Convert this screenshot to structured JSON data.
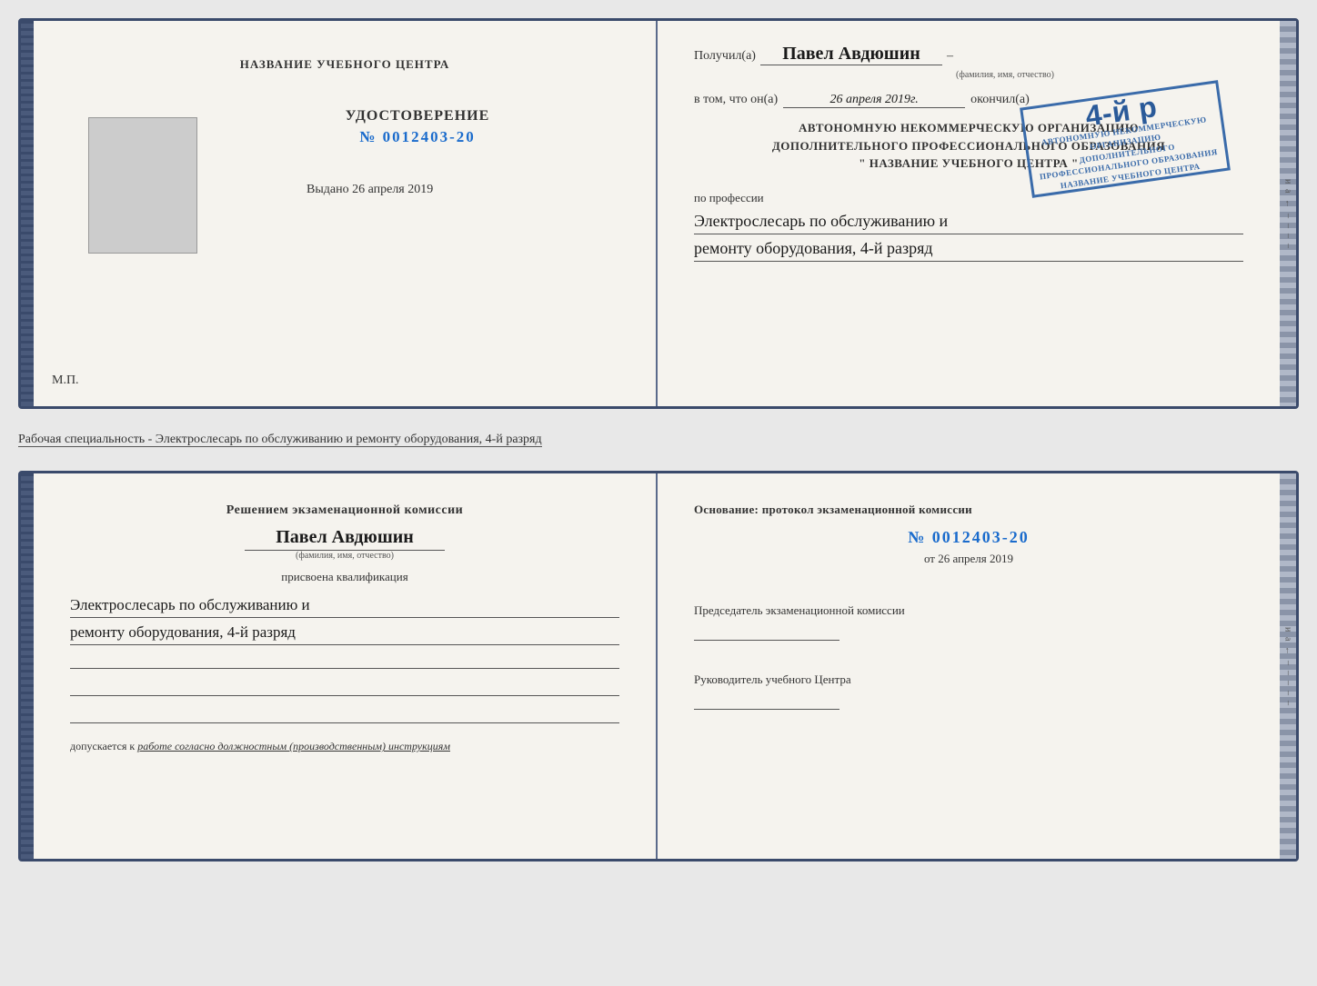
{
  "topDoc": {
    "leftPage": {
      "header": "НАЗВАНИЕ УЧЕБНОГО ЦЕНТРА",
      "certLabel": "УДОСТОВЕРЕНИЕ",
      "certNumber": "№ 0012403-20",
      "issuedLabel": "Выдано",
      "issuedDate": "26 апреля 2019",
      "mpLabel": "М.П."
    },
    "rightPage": {
      "receivedLabel": "Получил(а)",
      "recipientName": "Павел Авдюшин",
      "nameSubLabel": "(фамилия, имя, отчество)",
      "vtomLabel": "в том, что он(а)",
      "completionDate": "26 апреля 2019г.",
      "finishedLabel": "окончил(а)",
      "orgLine1": "АВТОНОМНУЮ НЕКОММЕРЧЕСКУЮ ОРГАНИЗАЦИЮ",
      "orgLine2": "ДОПОЛНИТЕЛЬНОГО ПРОФЕССИОНАЛЬНОГО ОБРАЗОВАНИЯ",
      "orgLine3": "\" НАЗВАНИЕ УЧЕБНОГО ЦЕНТРА \"",
      "professionLabel": "по профессии",
      "professionLine1": "Электрослесарь по обслуживанию и",
      "professionLine2": "ремонту оборудования, 4-й разряд",
      "stamp": {
        "line1": "4-й р",
        "line2": "АВТОНОМНУЮ НЕКОММЕРЧЕСКУЮ ОРГАНИЗАЦИЮ",
        "line3": "ДОПОЛНИТЕЛЬНОГО ПРОФЕССИОНАЛЬНОГО ОБРАЗОВАНИЯ",
        "line4": "НАЗВАНИЕ УЧЕБНОГО ЦЕНТРА"
      }
    }
  },
  "specialtyText": "Рабочая специальность - Электрослесарь по обслуживанию и ремонту оборудования, 4-й разряд",
  "bottomDoc": {
    "leftPage": {
      "commissionText": "Решением экзаменационной комиссии",
      "name": "Павел Авдюшин",
      "nameSubLabel": "(фамилия, имя, отчество)",
      "assignedText": "присвоена квалификация",
      "qualLine1": "Электрослесарь по обслуживанию и",
      "qualLine2": "ремонту оборудования, 4-й разряд",
      "allowedLabel": "допускается к",
      "allowedText": "работе согласно должностным (производственным) инструкциям"
    },
    "rightPage": {
      "basisLabel": "Основание: протокол экзаменационной комиссии",
      "protocolNumber": "№ 0012403-20",
      "fromLabel": "от",
      "fromDate": "26 апреля 2019",
      "chairmanLabel": "Председатель экзаменационной комиссии",
      "headLabel": "Руководитель учебного Центра"
    }
  },
  "edgeChars": [
    "и",
    "а",
    "←",
    "–",
    "–",
    "–",
    "–",
    "–"
  ]
}
